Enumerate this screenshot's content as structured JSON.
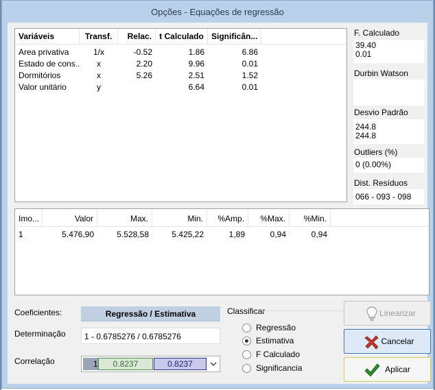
{
  "window": {
    "title": "Opções - Equações de regressão"
  },
  "variables_table": {
    "columns": [
      "Variáveis",
      "Transf.",
      "Relac.",
      "t Calculado",
      "Significân..."
    ],
    "rows": [
      [
        "Area privativa",
        "1/x",
        "-0.52",
        "1.86",
        "6.86"
      ],
      [
        "Estado de cons...",
        "x",
        "2.20",
        "9.96",
        "0.01"
      ],
      [
        "Dormitórios",
        "x",
        "5.26",
        "2.51",
        "1.52"
      ],
      [
        "Valor unitário",
        "y",
        "",
        "6.64",
        "0.01"
      ]
    ]
  },
  "stats": {
    "f_calculado": {
      "label": "F. Calculado",
      "line1": "39.40",
      "line2": "0.01"
    },
    "durbin_watson": {
      "label": "Durbin Watson",
      "value": ""
    },
    "desvio_padrao": {
      "label": "Desvio Padrão",
      "line1": "244.8",
      "line2": "244.8"
    },
    "outliers": {
      "label": "Outliers (%)",
      "value": "0  (0.00%)"
    },
    "dist_residuos": {
      "label": "Dist. Resíduos",
      "value": "066 - 093 - 098"
    }
  },
  "estimates_table": {
    "columns": [
      "Imo...",
      "Valor",
      "Max.",
      "Min.",
      "%Amp.",
      "%Max.",
      "%Min."
    ],
    "rows": [
      [
        "1",
        "5.476,90",
        "5.528,58",
        "5.425,22",
        "1,89",
        "0,94",
        "0,94"
      ]
    ]
  },
  "coeficientes": {
    "label": "Coeficientes:",
    "header": "Regressão / Estimativa",
    "determinacao_label": "Determinação",
    "determinacao_value": "1 -  0.6785276  /  0.6785276",
    "correlacao_label": "Correlação",
    "correlacao_prefix": "1",
    "correlacao_a": "0.8237",
    "correlacao_b": "0.8237"
  },
  "classificar": {
    "label": "Classificar",
    "options": [
      "Regressão",
      "Estimativa",
      "F Calculado",
      "Significancia"
    ],
    "selected": "Estimativa"
  },
  "buttons": {
    "linearizar": "Linearizar",
    "cancelar": "Cancelar",
    "aplicar": "Aplicar"
  },
  "colors": {
    "title_bar": "#b9d1ea",
    "coef_header": "#c0cfe2",
    "corr_green": "#d8e8d4",
    "corr_blue": "#c9c9ee",
    "cancel_icon": "#c0392b",
    "apply_icon": "#2e8b2e"
  },
  "icons": {
    "linearizar": "lightbulb-icon",
    "cancelar": "x-cancel-icon",
    "aplicar": "checkmark-icon",
    "dropdown": "chevron-down-icon"
  }
}
